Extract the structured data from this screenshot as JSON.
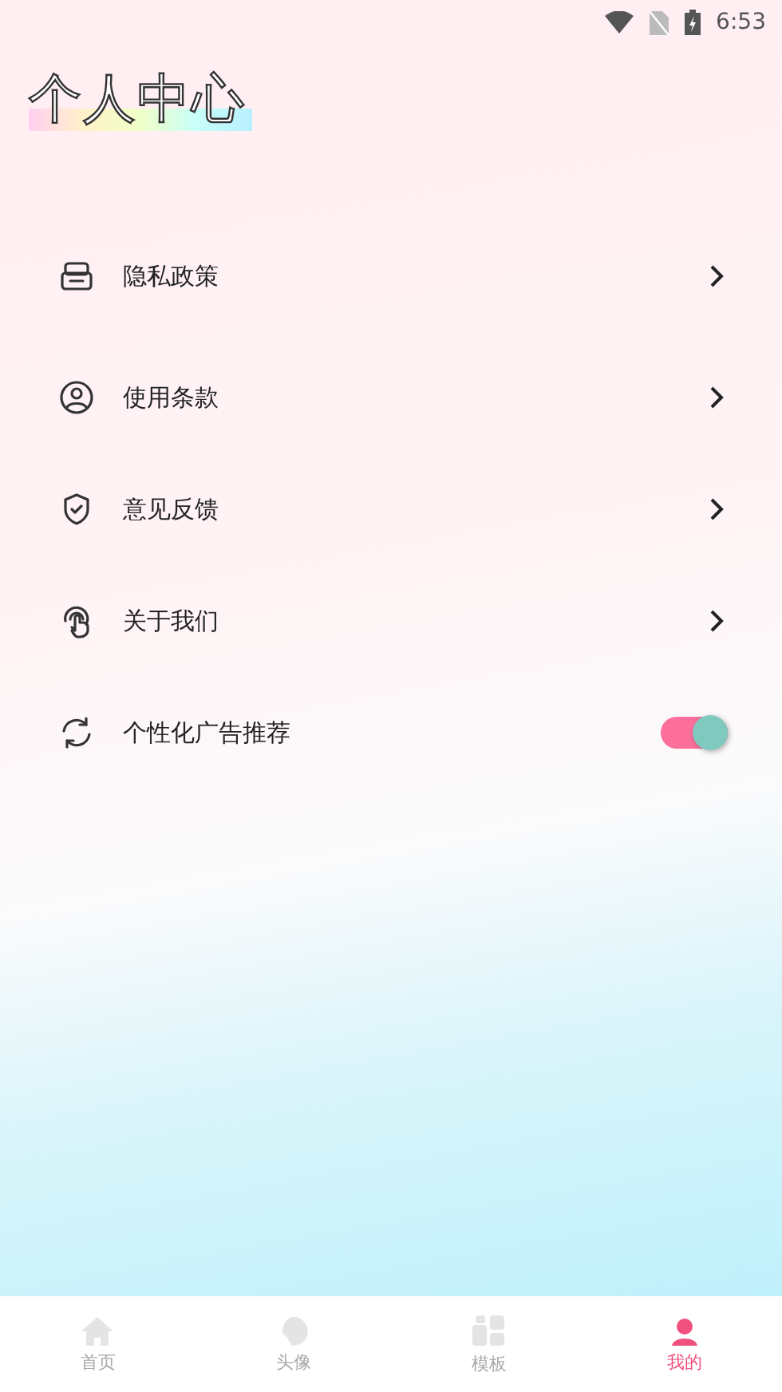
{
  "status_bar": {
    "time": "6:53"
  },
  "title": "个人中心",
  "menu": [
    {
      "kind": "link",
      "label": "隐私政策"
    },
    {
      "kind": "link",
      "label": "使用条款"
    },
    {
      "kind": "link",
      "label": "意见反馈"
    },
    {
      "kind": "link",
      "label": "关于我们"
    },
    {
      "kind": "toggle",
      "label": "个性化广告推荐",
      "on": true
    }
  ],
  "nav": [
    {
      "label": "首页",
      "selected": false
    },
    {
      "label": "头像",
      "selected": false
    },
    {
      "label": "模板",
      "selected": false
    },
    {
      "label": "我的",
      "selected": true
    }
  ]
}
